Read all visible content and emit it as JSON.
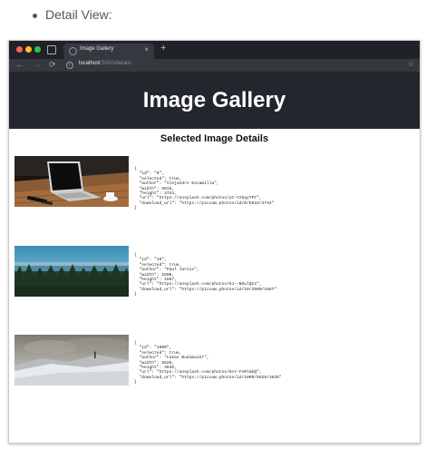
{
  "caption": "Detail View:",
  "browser": {
    "tab_title": "Image Gallery",
    "tab_close": "×",
    "new_tab": "+",
    "back": "←",
    "forward": "→",
    "reload": "⟳",
    "url_host": "localhost",
    "url_rest": ":5000/details"
  },
  "page": {
    "heading": "Image Gallery",
    "section_title": "Selected Image Details"
  },
  "images": [
    {
      "thumbnail_icon": "laptop-on-desk-photo",
      "json_text": "{\n  \"id\": \"0\",\n  \"selected\": true,\n  \"author\": \"Alejandro Escamilla\",\n  \"width\": 5616,\n  \"height\": 3744,\n  \"url\": \"https://unsplash.com/photos/yC-Yzbqy7PY\",\n  \"download_url\": \"https://picsum.photos/id/0/5616/3744\"\n}"
    },
    {
      "thumbnail_icon": "forest-lake-photo",
      "json_text": "{\n  \"id\": \"10\",\n  \"selected\": true,\n  \"author\": \"Paul Jarvis\",\n  \"width\": 2500,\n  \"height\": 1667,\n  \"url\": \"https://unsplash.com/photos/6J--NXulQCs\",\n  \"download_url\": \"https://picsum.photos/id/10/2500/1667\"\n}"
    },
    {
      "thumbnail_icon": "snowy-mountain-photo",
      "json_text": "{\n  \"id\": \"1000\",\n  \"selected\": true,\n  \"author\": \"Lukas Budimaier\",\n  \"width\": 5626,\n  \"height\": 3635,\n  \"url\": \"https://unsplash.com/photos/6cY-FvMlmkQ\",\n  \"download_url\": \"https://picsum.photos/id/1000/5626/3635\"\n}"
    }
  ]
}
